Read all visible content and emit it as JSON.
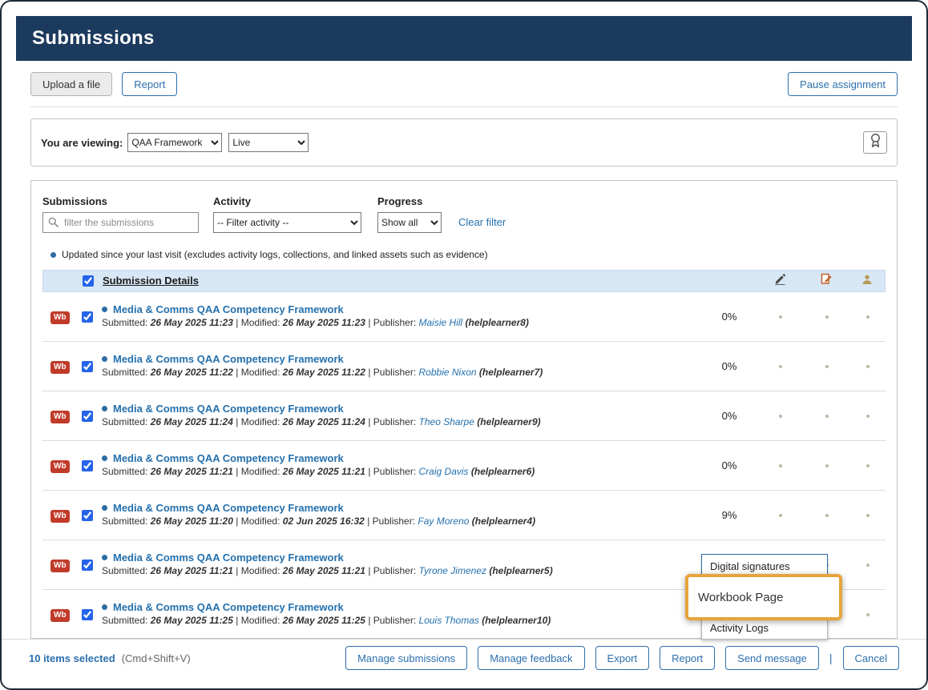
{
  "header": {
    "title": "Submissions"
  },
  "toolbar": {
    "upload": "Upload a file",
    "report": "Report",
    "pause": "Pause assignment"
  },
  "viewing": {
    "label": "You are viewing:",
    "workspace": "QAA Framework",
    "mode": "Live"
  },
  "filters": {
    "submissions_label": "Submissions",
    "search_placeholder": "filter the submissions",
    "activity_label": "Activity",
    "activity_value": "-- Filter activity --",
    "progress_label": "Progress",
    "progress_value": "Show all",
    "clear": "Clear filter"
  },
  "legend": {
    "text": "Updated since your last visit (excludes activity logs, collections, and linked assets such as evidence)"
  },
  "table": {
    "header": "Submission Details",
    "meta_labels": {
      "submitted": "Submitted:",
      "modified": "Modified:",
      "publisher": "Publisher:",
      "sep": "|"
    },
    "rows": [
      {
        "badge": "Wb",
        "title": "Media & Comms QAA Competency Framework",
        "submitted": "26 May 2025 11:23",
        "modified": "26 May 2025 11:23",
        "publisher": "Maisie Hill",
        "username": "(helplearner8)",
        "progress": "0%"
      },
      {
        "badge": "Wb",
        "title": "Media & Comms QAA Competency Framework",
        "submitted": "26 May 2025 11:22",
        "modified": "26 May 2025 11:22",
        "publisher": "Robbie Nixon",
        "username": "(helplearner7)",
        "progress": "0%"
      },
      {
        "badge": "Wb",
        "title": "Media & Comms QAA Competency Framework",
        "submitted": "26 May 2025 11:24",
        "modified": "26 May 2025 11:24",
        "publisher": "Theo Sharpe",
        "username": "(helplearner9)",
        "progress": "0%"
      },
      {
        "badge": "Wb",
        "title": "Media & Comms QAA Competency Framework",
        "submitted": "26 May 2025 11:21",
        "modified": "26 May 2025 11:21",
        "publisher": "Craig Davis",
        "username": "(helplearner6)",
        "progress": "0%"
      },
      {
        "badge": "Wb",
        "title": "Media & Comms QAA Competency Framework",
        "submitted": "26 May 2025 11:20",
        "modified": "02 Jun 2025 16:32",
        "publisher": "Fay Moreno",
        "username": "(helplearner4)",
        "progress": "9%"
      },
      {
        "badge": "Wb",
        "title": "Media & Comms QAA Competency Framework",
        "submitted": "26 May 2025 11:21",
        "modified": "26 May 2025 11:21",
        "publisher": "Tyrone Jimenez",
        "username": "(helplearner5)",
        "progress": ""
      },
      {
        "badge": "Wb",
        "title": "Media & Comms QAA Competency Framework",
        "submitted": "26 May 2025 11:25",
        "modified": "26 May 2025 11:25",
        "publisher": "Louis Thomas",
        "username": "(helplearner10)",
        "progress": ""
      }
    ]
  },
  "context_menu": {
    "items": [
      "Digital signatures",
      "Workbook Page",
      "Activity Logs"
    ]
  },
  "footer": {
    "selected": "10 items selected",
    "shortcut": "(Cmd+Shift+V)",
    "buttons": [
      "Manage submissions",
      "Manage feedback",
      "Export",
      "Report",
      "Send message"
    ],
    "divider": "|",
    "cancel": "Cancel"
  },
  "colors": {
    "header_bg": "#1c3a5e",
    "accent": "#2c6fad",
    "badge_bg": "#c13b2a",
    "highlight_border": "#e7a33c",
    "table_header_bg": "#d7e7f5"
  }
}
